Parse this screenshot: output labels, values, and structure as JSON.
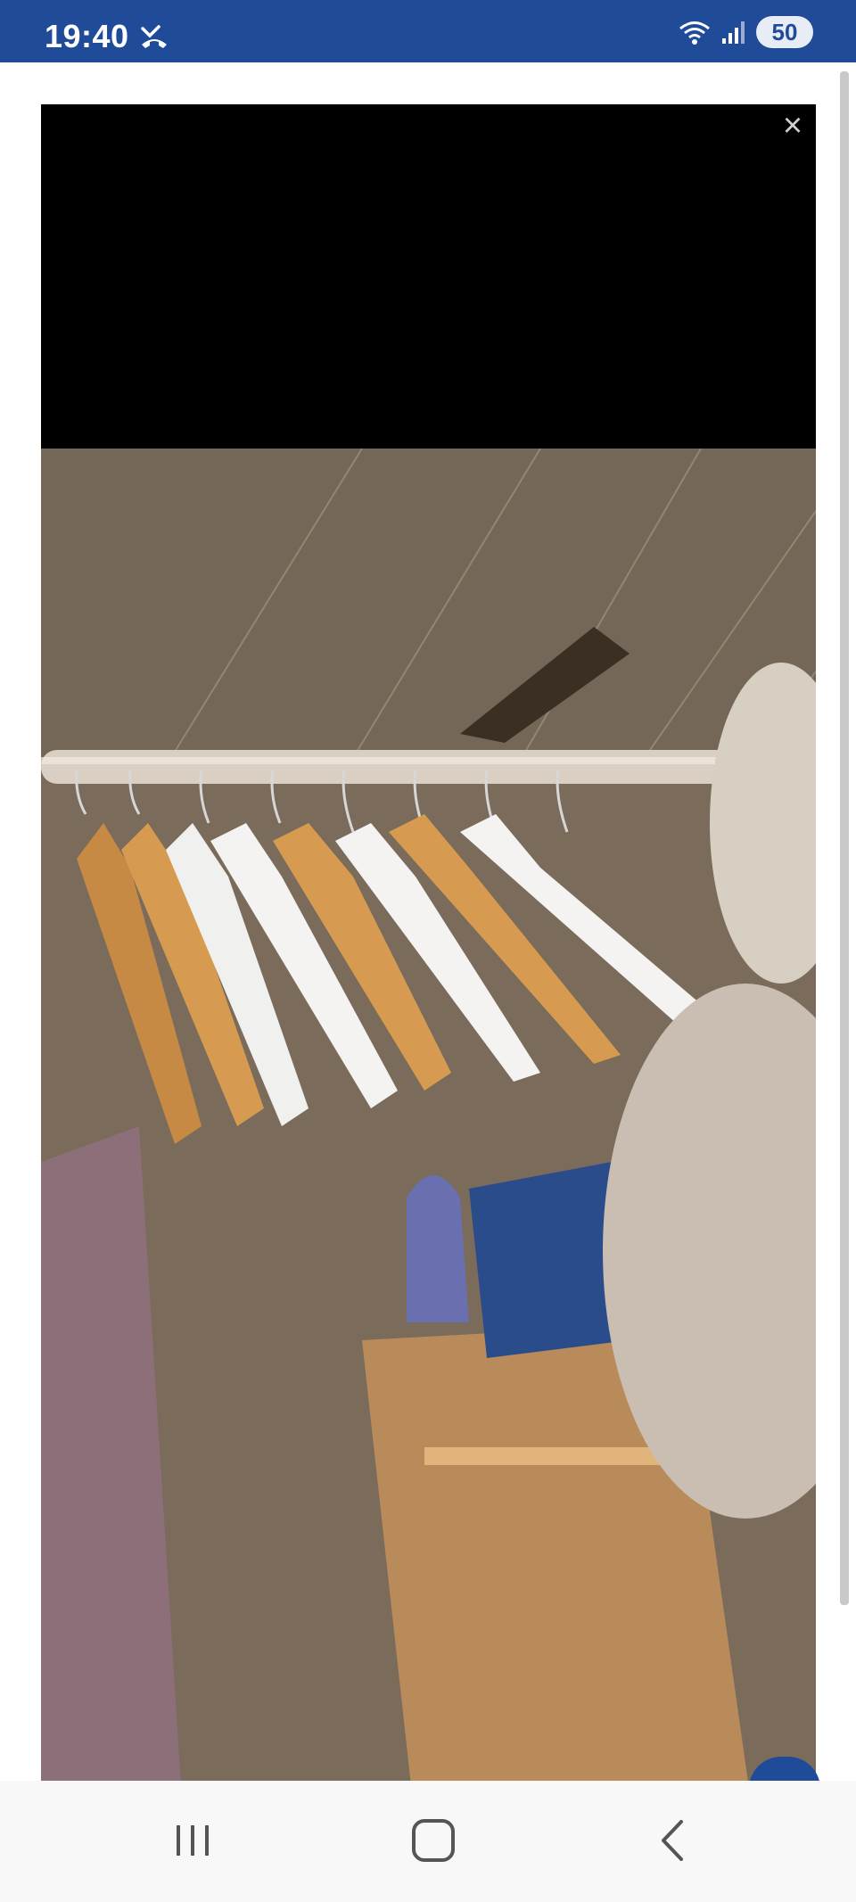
{
  "status_bar": {
    "time": "19:40",
    "missed_call_icon": "missed-call-icon",
    "wifi_icon": "wifi-icon",
    "signal_icon": "signal-icon",
    "battery_level": "50"
  },
  "viewer": {
    "close_label": "×",
    "image_icon": "photo-clothes-hangers-on-rail"
  },
  "nav_bar": {
    "recents_icon": "recents-icon",
    "home_icon": "home-icon",
    "back_icon": "back-icon"
  },
  "colors": {
    "status_bar_bg": "#1f4b99",
    "viewer_bg": "#000000",
    "nav_bar_bg": "#f8f8f8"
  }
}
